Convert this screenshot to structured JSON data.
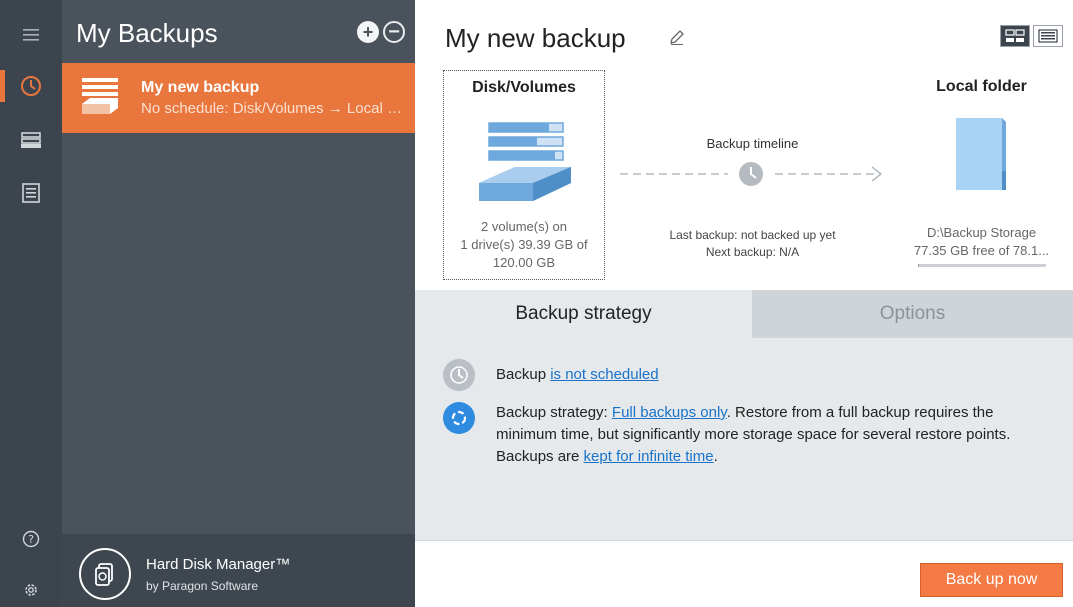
{
  "rail": {
    "menu_icon": "hamburger-icon",
    "items": [
      {
        "icon": "history-clock-icon",
        "active": true
      },
      {
        "icon": "drives-icon",
        "active": false
      },
      {
        "icon": "log-list-icon",
        "active": false
      }
    ],
    "help_icon": "help-icon",
    "settings_icon": "gear-icon"
  },
  "panel": {
    "title": "My Backups",
    "backup_item": {
      "name": "My new backup",
      "subtitle": "No schedule: Disk/Volumes → Local folder"
    },
    "brand": {
      "name": "Hard Disk Manager™",
      "by": "by Paragon Software"
    }
  },
  "main": {
    "title": "My new backup",
    "source": {
      "title": "Disk/Volumes",
      "info_line1": "2 volume(s) on",
      "info_line2": "1 drive(s) 39.39 GB of",
      "info_line3": "120.00 GB"
    },
    "timeline": {
      "title": "Backup timeline",
      "last_backup": "Last backup: not backed up yet",
      "next_backup": "Next backup: N/A"
    },
    "destination": {
      "title": "Local folder",
      "path": "D:\\Backup Storage",
      "free": "77.35 GB free of 78.1...",
      "used_fraction": 0.01
    },
    "tabs": [
      "Backup strategy",
      "Options"
    ],
    "strategy": {
      "schedule_prefix": "Backup ",
      "schedule_link": "is not scheduled",
      "strategy_prefix": "Backup strategy: ",
      "strategy_link": "Full backups only",
      "strategy_mid": ". Restore from a full backup requires the minimum time, but significantly more storage space for several restore points. Backups are ",
      "retention_link": "kept for infinite time",
      "strategy_suffix": "."
    },
    "primary_button": "Back up now"
  },
  "colors": {
    "accent": "#e8763d",
    "button": "#f47b45",
    "rail": "#3c454d",
    "panel": "#4a535b",
    "link": "#1a73c9",
    "drive_blue": "#6fa8dc",
    "folder_blue": "#a9d3f5"
  }
}
